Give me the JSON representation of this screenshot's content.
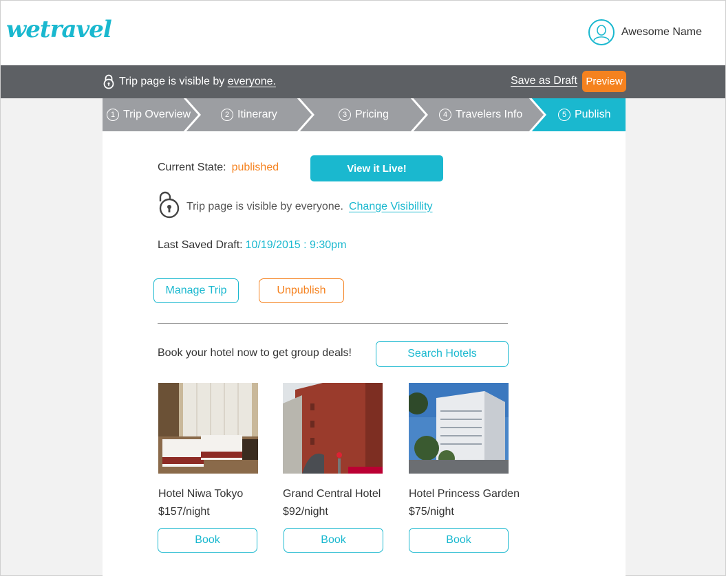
{
  "header": {
    "logo": "wetravel",
    "user_name": "Awesome Name"
  },
  "toolbar": {
    "visibility_prefix": "Trip page is visible by",
    "visibility_link": "everyone.",
    "save_draft": "Save as Draft",
    "preview": "Preview"
  },
  "steps": [
    {
      "num": "1",
      "label": "Trip Overview",
      "active": false
    },
    {
      "num": "2",
      "label": "Itinerary",
      "active": false
    },
    {
      "num": "3",
      "label": "Pricing",
      "active": false
    },
    {
      "num": "4",
      "label": "Travelers Info",
      "active": false
    },
    {
      "num": "5",
      "label": "Publish",
      "active": true
    }
  ],
  "publish": {
    "current_state_label": "Current State:",
    "current_state_value": "published",
    "view_live": "View it Live!",
    "visibility_text": "Trip page is visible by everyone.",
    "change_visibility": "Change Visibillity",
    "last_saved_label": "Last Saved Draft:",
    "last_saved_value": "10/19/2015 : 9:30pm",
    "manage_trip": "Manage Trip",
    "unpublish": "Unpublish"
  },
  "hotels_section": {
    "prompt": "Book your hotel now to get group deals!",
    "search_button": "Search Hotels",
    "book_label": "Book",
    "hotels": [
      {
        "name": "Hotel Niwa Tokyo",
        "price": "$157/night"
      },
      {
        "name": "Grand Central Hotel",
        "price": "$92/night"
      },
      {
        "name": "Hotel Princess Garden",
        "price": "$75/night"
      }
    ]
  },
  "colors": {
    "brand_teal": "#1ab8cf",
    "accent_orange": "#f5821f",
    "toolbar_grey": "#5d6064",
    "step_inactive": "#9c9ea2"
  }
}
